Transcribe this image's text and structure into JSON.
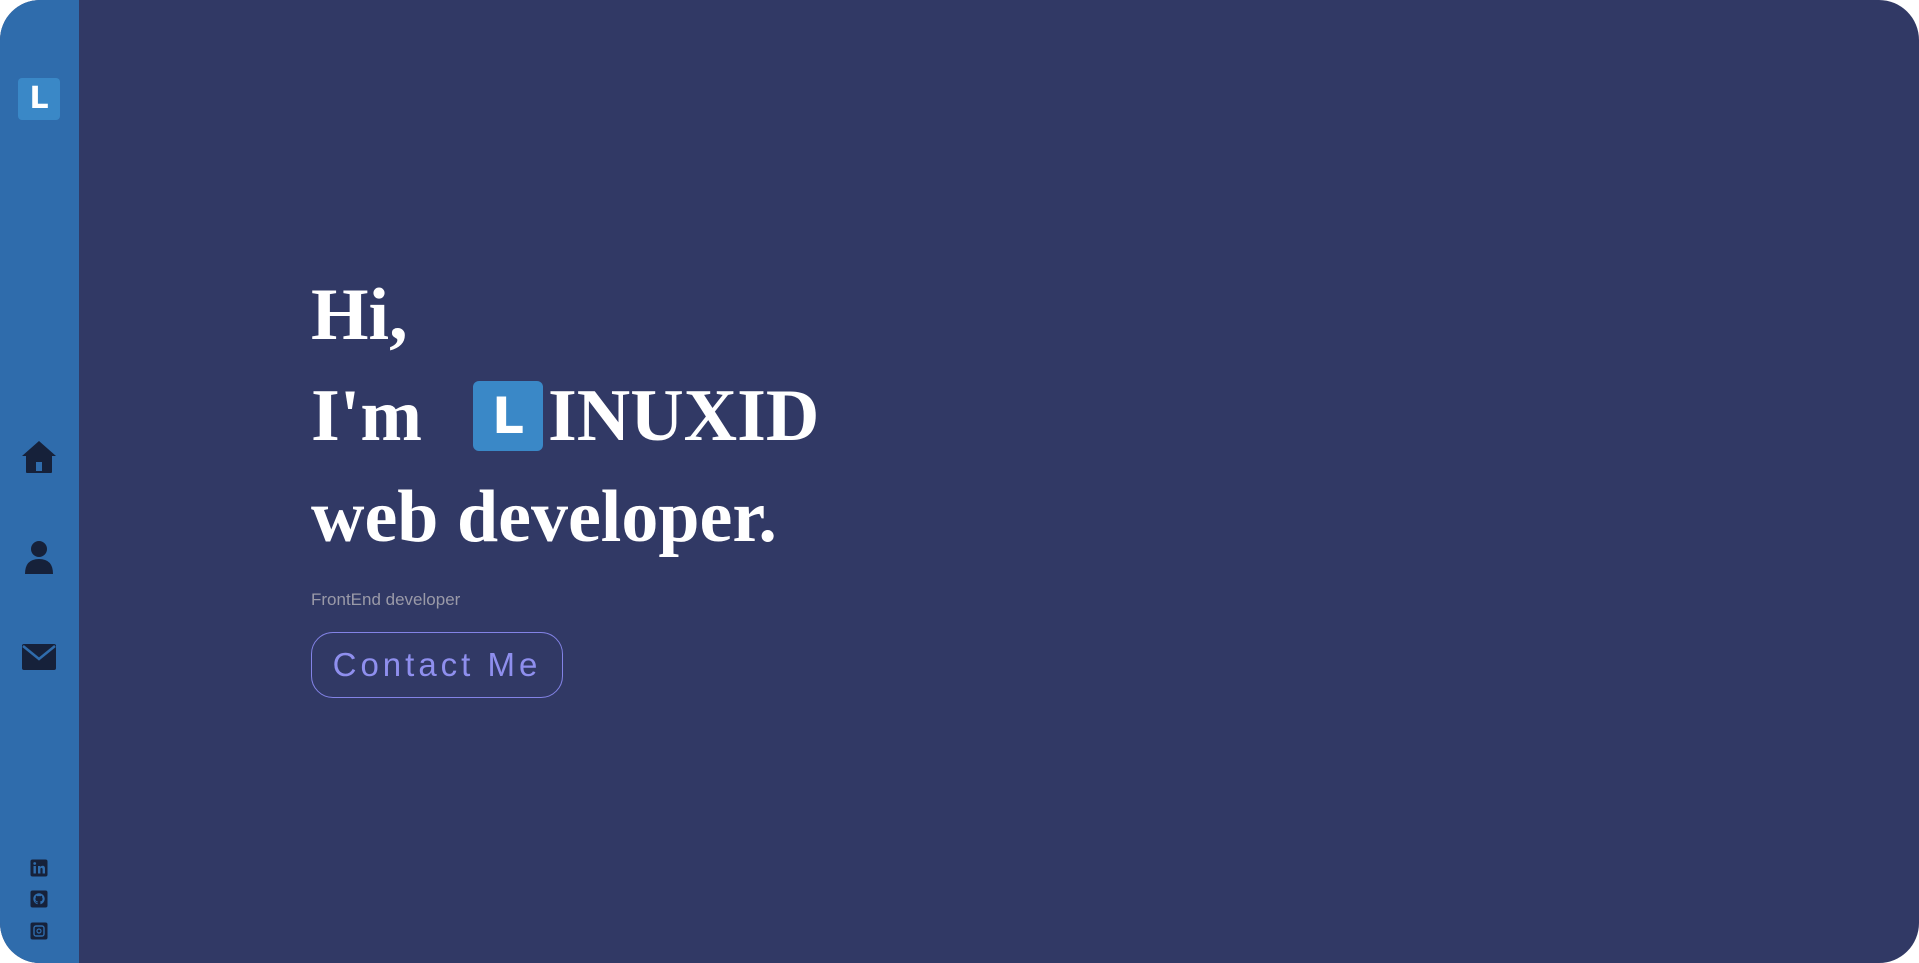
{
  "sidebar": {
    "logo_letter": "L",
    "nav": [
      {
        "icon": "home-icon"
      },
      {
        "icon": "user-icon"
      },
      {
        "icon": "mail-icon"
      }
    ],
    "social": [
      {
        "icon": "linkedin-icon"
      },
      {
        "icon": "github-icon"
      },
      {
        "icon": "codepen-icon"
      }
    ]
  },
  "hero": {
    "line1": "Hi,",
    "line2_prefix": "I'm",
    "name_badge_letter": "L",
    "name_rest": "INUXID",
    "line3": "web developer.",
    "subtitle": "FrontEnd developer",
    "cta_label": "Contact Me"
  },
  "colors": {
    "background": "#313965",
    "sidebar": "#2f6cac",
    "badge": "#3a88c7",
    "accent": "#8383e6",
    "heading": "#ffffff",
    "subtitle": "#9a9aa8",
    "icon_dark": "#16213a"
  }
}
